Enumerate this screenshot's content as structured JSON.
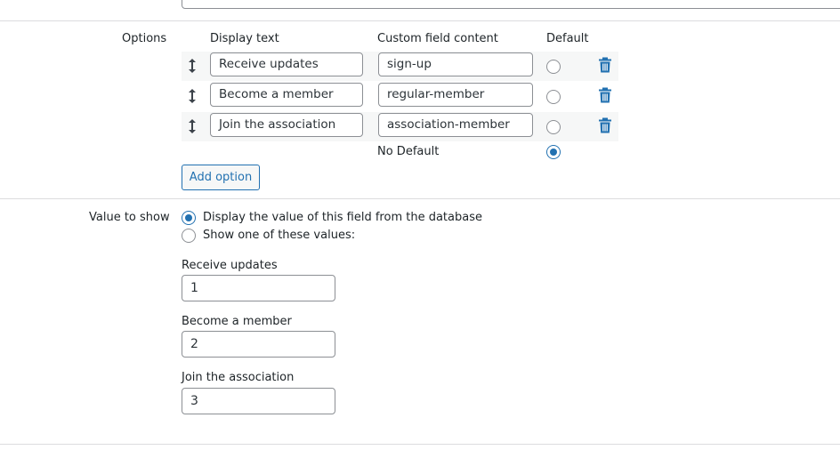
{
  "options_section": {
    "label": "Options",
    "columns": {
      "display_text": "Display text",
      "custom_field_content": "Custom field content",
      "default": "Default"
    },
    "rows": [
      {
        "display_text": "Receive updates",
        "custom_field_content": "sign-up",
        "default_selected": false
      },
      {
        "display_text": "Become a member",
        "custom_field_content": "regular-member",
        "default_selected": false
      },
      {
        "display_text": "Join the association",
        "custom_field_content": "association-member",
        "default_selected": false
      }
    ],
    "no_default_label": "No Default",
    "no_default_selected": true,
    "add_option_label": "Add option"
  },
  "value_section": {
    "label": "Value to show",
    "choices": [
      {
        "label": "Display the value of this field from the database",
        "selected": true
      },
      {
        "label": "Show one of these values:",
        "selected": false
      }
    ],
    "values": [
      {
        "label": "Receive updates",
        "value": "1"
      },
      {
        "label": "Become a member",
        "value": "2"
      },
      {
        "label": "Join the association",
        "value": "3"
      }
    ]
  },
  "icons": {
    "drag": "drag-handle-icon",
    "delete": "trash-icon"
  },
  "colors": {
    "accent": "#2271b1",
    "border": "#8c8f94",
    "divider": "#dcdcde",
    "row_background": "#f6f7f7"
  }
}
